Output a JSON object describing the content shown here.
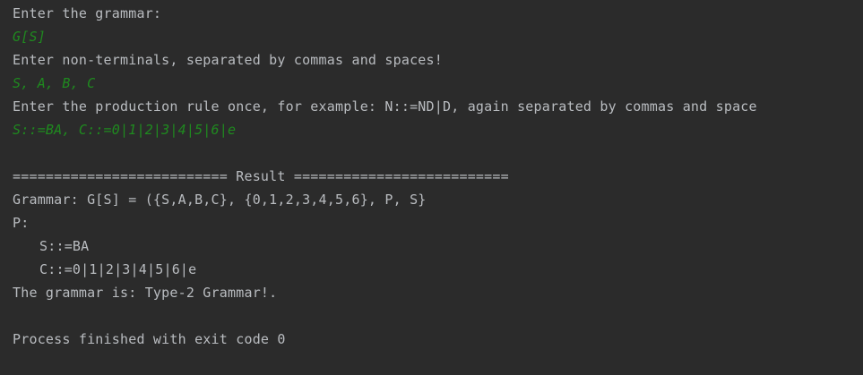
{
  "console": {
    "prompt_grammar": "Enter the grammar:",
    "input_grammar": "G[S]",
    "prompt_nonterminals": "Enter non-terminals, separated by commas and spaces!",
    "input_nonterminals": "S, A, B, C",
    "prompt_production": "Enter the production rule once, for example: N::=ND|D, again separated by commas and space",
    "input_production": "S::=BA, C::=0|1|2|3|4|5|6|e",
    "result_header": "========================== Result ==========================",
    "grammar_line": "Grammar: G[S] = ({S,A,B,C}, {0,1,2,3,4,5,6}, P, S}",
    "p_label": "P:",
    "rules": [
      "S::=BA",
      "C::=0|1|2|3|4|5|6|e"
    ],
    "grammar_type_line": "The grammar is: Type-2 Grammar!.",
    "process_finished": "Process finished with exit code 0"
  },
  "colors": {
    "background": "#2b2b2b",
    "output_text": "#b9bcc0",
    "user_input_text": "#1f8a1f"
  }
}
